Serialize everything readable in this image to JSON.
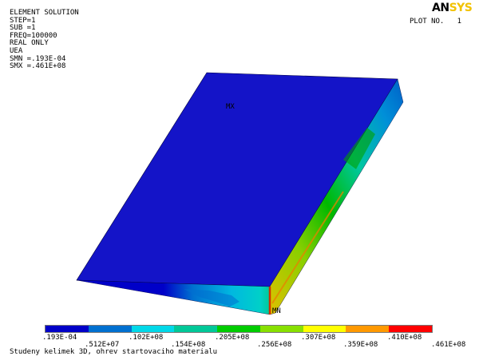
{
  "window": {
    "info_lines": [
      "ELEMENT SOLUTION",
      "STEP=1",
      "SUB =1",
      "FREQ=100000",
      "REAL ONLY",
      "UEA",
      "SMN =.193E-04",
      "SMX =.461E+08"
    ],
    "logo_an": "AN",
    "logo_sys": "SYS",
    "plot_no": "PLOT NO.   1"
  },
  "legend": {
    "colors": [
      "#0000c8",
      "#0070d0",
      "#00d8e8",
      "#00c898",
      "#00cc00",
      "#88e000",
      "#ffff00",
      "#ff9900",
      "#ff0000"
    ],
    "labels_top": [
      ".193E-04",
      ".102E+08",
      ".205E+08",
      ".307E+08",
      ".410E+08"
    ],
    "labels_bottom": [
      ".512E+07",
      ".154E+08",
      ".256E+08",
      ".359E+08",
      ".461E+08"
    ]
  },
  "model": {
    "node_label_mx": "MX",
    "node_label_mn": "MN"
  },
  "subtitle": "Studeny kelimek 3D, ohrev startovaciho materialu"
}
